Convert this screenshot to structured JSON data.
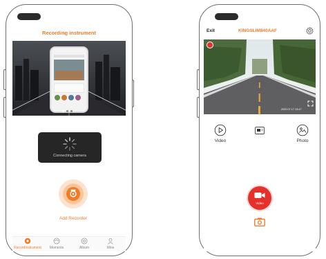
{
  "left": {
    "title": "Recording instrument",
    "connecting_text": "Connecting camera",
    "add_recorder_label": "Add Recorder",
    "tabs": [
      {
        "label": "RecordInstrument",
        "icon": "camera-icon",
        "active": true
      },
      {
        "label": "Moments",
        "icon": "moments-icon",
        "active": false
      },
      {
        "label": "Album",
        "icon": "album-icon",
        "active": false
      },
      {
        "label": "Mine",
        "icon": "user-icon",
        "active": false
      }
    ]
  },
  "right": {
    "exit_label": "Exit",
    "device_name": "KINGSLIM840AAF",
    "timestamp": "2020.07.17 13:47",
    "actions": [
      {
        "label": "Video",
        "icon": "play-icon"
      },
      {
        "label": "",
        "icon": "sd-card-icon"
      },
      {
        "label": "Photo",
        "icon": "photo-icon"
      }
    ],
    "record_button_label": "Video"
  },
  "colors": {
    "accent": "#f07c2a",
    "record_red": "#e5312c",
    "frame": "#6d6d6d"
  }
}
